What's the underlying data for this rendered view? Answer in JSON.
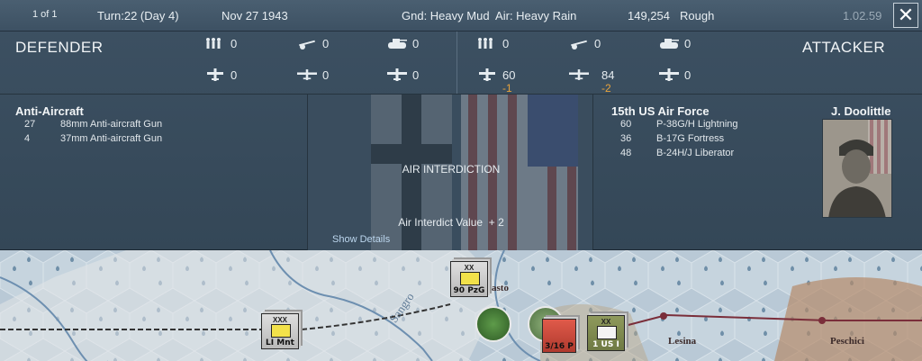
{
  "topbar": {
    "page": "1 of 1",
    "turn": "Turn:22 (Day 4)",
    "date": "Nov 27 1943",
    "weather": "Gnd: Heavy Mud  Air: Heavy Rain",
    "location_id": "149,254",
    "terrain": "Rough",
    "version": "1.02.59",
    "close": "✕"
  },
  "defender": {
    "title": "DEFENDER",
    "infantry": "0",
    "guns": "0",
    "tanks": "0",
    "fighters": "0",
    "bombers": "0",
    "other_air": "0"
  },
  "attacker": {
    "title": "ATTACKER",
    "infantry": "0",
    "guns": "0",
    "tanks": "0",
    "fighters": "60",
    "fighters_loss": "-1",
    "bombers": "84",
    "bombers_loss": "-2",
    "other_air": "0"
  },
  "defense_box": {
    "title": "Anti-Aircraft",
    "rows": [
      {
        "count": "27",
        "name": "88mm Anti-aircraft Gun"
      },
      {
        "count": "4",
        "name": "37mm Anti-aircraft Gun"
      }
    ]
  },
  "middle_box": {
    "title": "AIR INTERDICTION",
    "value_label": "Air Interdict Value  + 2",
    "details_link": "Show Details"
  },
  "attack_box": {
    "title": "15th US Air Force",
    "commander": "J. Doolittle",
    "rows": [
      {
        "count": "60",
        "name": "P-38G/H Lightning"
      },
      {
        "count": "36",
        "name": "B-17G Fortress"
      },
      {
        "count": "48",
        "name": "B-24H/J Liberator"
      }
    ]
  },
  "map": {
    "counters": [
      {
        "size": "XX",
        "label": "90 PzG"
      },
      {
        "size": "XXX",
        "label": "LI Mnt"
      },
      {
        "size": "",
        "label": "3/16 P"
      },
      {
        "size": "XX",
        "label": "1 US I"
      }
    ],
    "towns": [
      "asto",
      "Lesina",
      "Peschici",
      "Sangro"
    ]
  }
}
